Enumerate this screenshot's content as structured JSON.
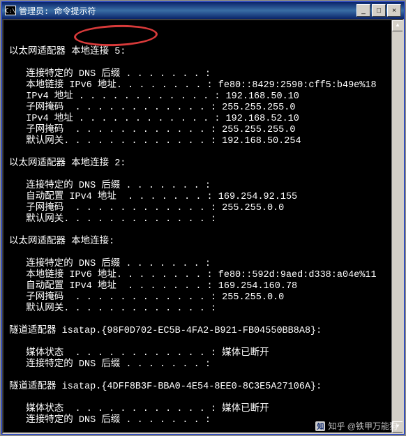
{
  "window": {
    "icon_label": "C:\\",
    "title": "管理员: 命令提示符"
  },
  "win_btns": {
    "min": "_",
    "max": "□",
    "close": "×"
  },
  "adapters": [
    {
      "header": "以太网适配器 本地连接 5:",
      "rows": [
        {
          "k": "   连接特定的 DNS 后缀 . . . . . . . :",
          "v": ""
        },
        {
          "k": "   本地链接 IPv6 地址. . . . . . . . :",
          "v": " fe80::8429:2590:cff5:b49e%18"
        },
        {
          "k": "   IPv4 地址 . . . . . . . . . . . . :",
          "v": " 192.168.50.10"
        },
        {
          "k": "   子网掩码  . . . . . . . . . . . . :",
          "v": " 255.255.255.0"
        },
        {
          "k": "   IPv4 地址 . . . . . . . . . . . . :",
          "v": " 192.168.52.10"
        },
        {
          "k": "   子网掩码  . . . . . . . . . . . . :",
          "v": " 255.255.255.0"
        },
        {
          "k": "   默认网关. . . . . . . . . . . . . :",
          "v": " 192.168.50.254"
        }
      ]
    },
    {
      "header": "以太网适配器 本地连接 2:",
      "rows": [
        {
          "k": "   连接特定的 DNS 后缀 . . . . . . . :",
          "v": ""
        },
        {
          "k": "   自动配置 IPv4 地址  . . . . . . . :",
          "v": " 169.254.92.155"
        },
        {
          "k": "   子网掩码  . . . . . . . . . . . . :",
          "v": " 255.255.0.0"
        },
        {
          "k": "   默认网关. . . . . . . . . . . . . :",
          "v": ""
        }
      ]
    },
    {
      "header": "以太网适配器 本地连接:",
      "rows": [
        {
          "k": "   连接特定的 DNS 后缀 . . . . . . . :",
          "v": ""
        },
        {
          "k": "   本地链接 IPv6 地址. . . . . . . . :",
          "v": " fe80::592d:9aed:d338:a04e%11"
        },
        {
          "k": "   自动配置 IPv4 地址  . . . . . . . :",
          "v": " 169.254.160.78"
        },
        {
          "k": "   子网掩码  . . . . . . . . . . . . :",
          "v": " 255.255.0.0"
        },
        {
          "k": "   默认网关. . . . . . . . . . . . . :",
          "v": ""
        }
      ]
    },
    {
      "header": "隧道适配器 isatap.{98F0D702-EC5B-4FA2-B921-FB04550BB8A8}:",
      "rows": [
        {
          "k": "   媒体状态  . . . . . . . . . . . . :",
          "v": " 媒体已断开"
        },
        {
          "k": "   连接特定的 DNS 后缀 . . . . . . . :",
          "v": ""
        }
      ]
    },
    {
      "header": "隧道适配器 isatap.{4DFF8B3F-BBA0-4E54-8EE0-8C3E5A27106A}:",
      "rows": [
        {
          "k": "   媒体状态  . . . . . . . . . . . . :",
          "v": " 媒体已断开"
        },
        {
          "k": "   连接特定的 DNS 后缀 . . . . . . . :",
          "v": ""
        }
      ]
    }
  ],
  "scroll_glyphs": {
    "up": "▲",
    "down": "▼"
  },
  "watermark": {
    "logo": "知",
    "text": "知乎 @铁甲万能狗"
  }
}
